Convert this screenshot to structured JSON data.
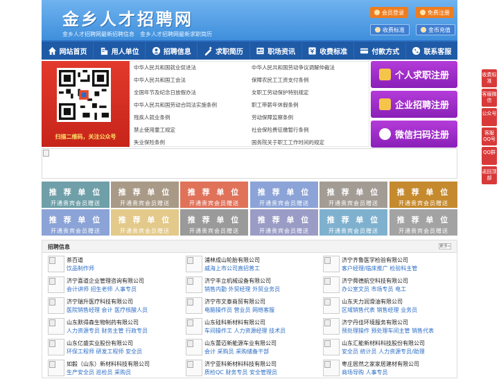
{
  "header": {
    "logo": "金乡人才招聘网",
    "slogan": "金乡人才招聘网最新招聘信息　金乡人才招聘网最新求职简历",
    "buttons": {
      "member_login": "会员登录",
      "free_register": "免费注册",
      "fee_standard": "收费标准",
      "coin_recharge": "金币充值"
    }
  },
  "nav": [
    {
      "label": "网站首页",
      "icon": "home-icon"
    },
    {
      "label": "用人单位",
      "icon": "building-icon"
    },
    {
      "label": "招聘信息",
      "icon": "recruit-icon"
    },
    {
      "label": "求职简历",
      "icon": "resume-icon"
    },
    {
      "label": "职场资讯",
      "icon": "news-icon"
    },
    {
      "label": "收费标准",
      "icon": "fee-icon"
    },
    {
      "label": "付款方式",
      "icon": "payment-icon"
    },
    {
      "label": "联系客服",
      "icon": "phone-icon"
    }
  ],
  "qr": {
    "caption": "扫描二维码，关注公众号"
  },
  "policy_links": {
    "left": [
      "中华人民共和国就业促进法",
      "中华人民共和国工会法",
      "全国年节及纪念日放假办法",
      "中华人民共和国劳动合同法实施条例",
      "残疾人就业条例",
      "禁止使用童工规定",
      "失业保险条例"
    ],
    "right": [
      "中华人民共和国劳动争议调解仲裁法",
      "保障农民工工资支付条例",
      "女职工劳动保护特别规定",
      "职工带薪年休假条例",
      "劳动保障监察条例",
      "社会保险费征缴暂行条例",
      "国务院关于职工工作时间的规定"
    ]
  },
  "cta": {
    "personal": "个人求职注册",
    "company": "企业招聘注册",
    "wechat": "微信扫码注册"
  },
  "recommended": {
    "title": "推 荐 单 位",
    "subtitle": "开通贵宾会员赠送",
    "colors": [
      "#6f9fa8",
      "#a89a86",
      "#e0725a",
      "#8ba3d6",
      "#a39c95",
      "#c58a2e",
      "#8ba3d6",
      "#e3c98a",
      "#9a9a9a",
      "#9a9cc6",
      "#7fb1cf",
      "#a3a3a3"
    ]
  },
  "listing": {
    "title": "招聘信息",
    "more": "更多»",
    "companies": [
      {
        "name": "茶百道",
        "jobs": "饮品制作师"
      },
      {
        "name": "浦林成山轮胎有限公司",
        "jobs": "威海上市公司直招普工"
      },
      {
        "name": "济宁齐鲁医学检验有限公司",
        "jobs": "客户经理/临床推广 检验科主管"
      },
      {
        "name": "济宁喜道企业管理咨询有限公司",
        "jobs": "会计讲师 招生老师 人事专员"
      },
      {
        "name": "济宁丰立机械设备有限公司",
        "jobs": "销售内勤 外贸经理 外贸业务员"
      },
      {
        "name": "济宁舜德航空科技有限公司",
        "jobs": "办公室文员 市场专员 电工"
      },
      {
        "name": "济宁瑞升医疗科技有限公司",
        "jobs": "医院销售经理 会计 医疗核酸人员"
      },
      {
        "name": "济宁市文泰商贸有限公司",
        "jobs": "电脑操作员 营业员 网络客服"
      },
      {
        "name": "山东天力润滑油有限公司",
        "jobs": "区域销售代表 销售经理 业务员"
      },
      {
        "name": "山东默得森生物制药有限公司",
        "jobs": "人力资源专员 财务主管 行政专员"
      },
      {
        "name": "山东硅科新材料有限公司",
        "jobs": "车间操作工 人力资源经理 技术员"
      },
      {
        "name": "济宁丹佳环境服务有限公司",
        "jobs": "预处理操作 预处理车间主管 销售代表"
      },
      {
        "name": "山东亿盛实业股份有限公司",
        "jobs": "环保工程师 研发工程师 安全员"
      },
      {
        "name": "山东蕾迈新能源车业有限公司",
        "jobs": "会计 采购员 采购储备干部"
      },
      {
        "name": "山东汇能新材料科技股份有限公司",
        "jobs": "安全员 统计员 人力资源专员/助理"
      },
      {
        "name": "如毅（山东）新材料科技有限公司",
        "jobs": "生产安全员 巡检员 采购员"
      },
      {
        "name": "济宁亚科新材料科技有限公司",
        "jobs": "质检QC 财务专员 安全管理员"
      },
      {
        "name": "枣庄居然之家家居建材有限公司",
        "jobs": "商场导购 人事专员"
      }
    ]
  },
  "sidebar": [
    {
      "label": "收费标准"
    },
    {
      "label": "客服微信"
    },
    {
      "label": "公众号"
    },
    {
      "label": "客服QQ号"
    },
    {
      "label": "QQ群"
    },
    {
      "label": "返回顶部"
    }
  ],
  "colors": {
    "header_blue": "#4a98e0",
    "nav_blue": "#1f5aa6",
    "cta_purple": "#9a2bc6",
    "accent_orange": "#ef7d1f",
    "side_red": "#d83a3a",
    "job_link": "#2b6cc4"
  }
}
